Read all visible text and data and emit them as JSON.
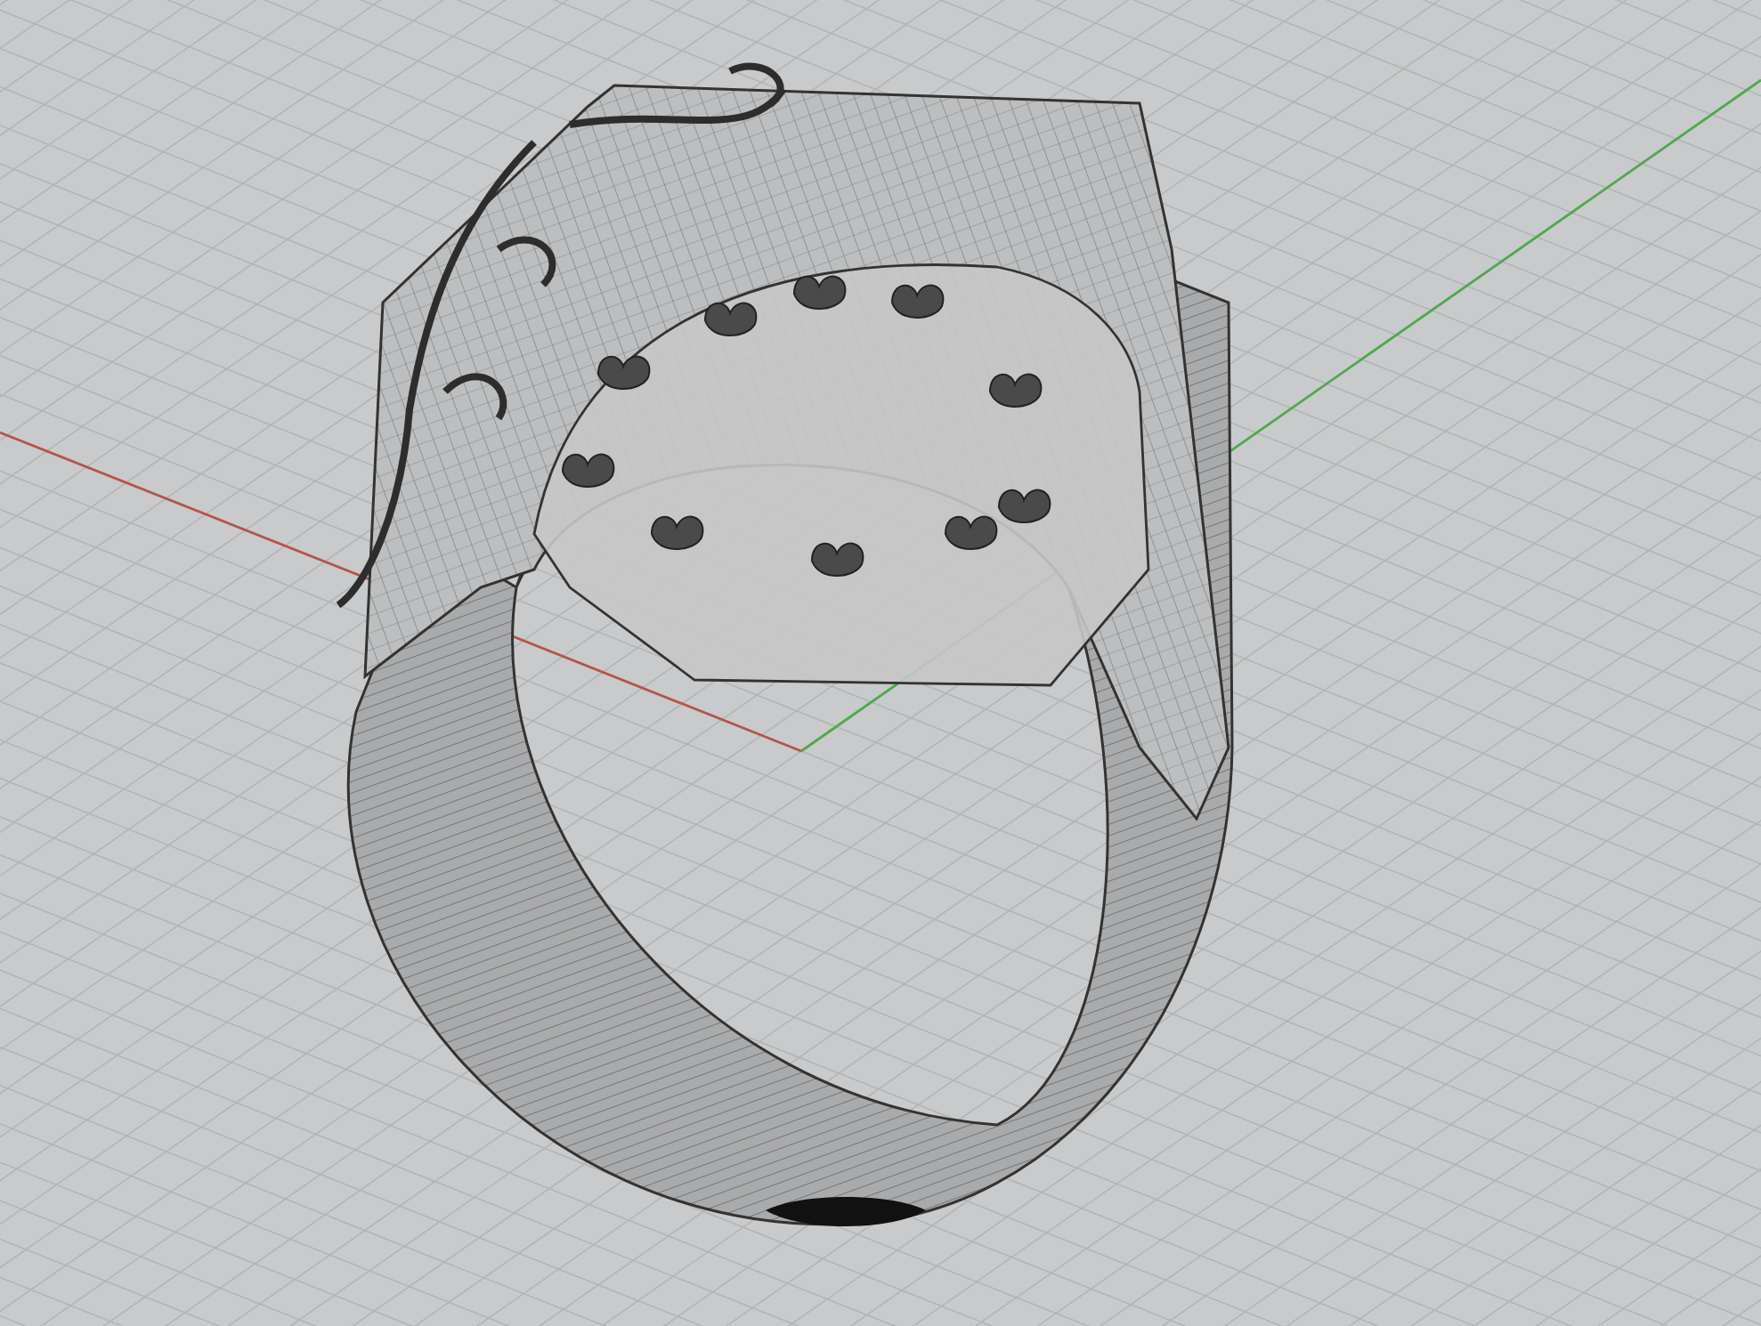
{
  "viewport": {
    "axes": [
      {
        "kind": "x",
        "color": "#b5544c"
      },
      {
        "kind": "y",
        "color": "#4daa4a"
      }
    ]
  }
}
